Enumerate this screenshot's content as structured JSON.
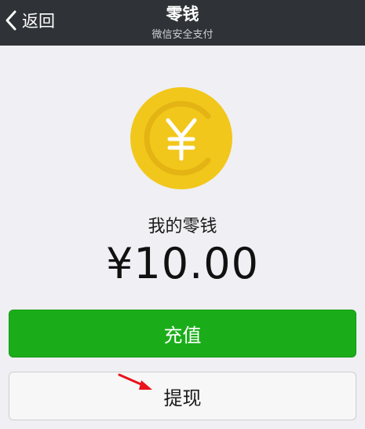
{
  "navbar": {
    "back_label": "返回",
    "title": "零钱",
    "subtitle": "微信安全支付"
  },
  "coin": {
    "symbol": "¥",
    "icon": "yuan-coin-icon",
    "color": "#f2c71b"
  },
  "balance": {
    "label": "我的零钱",
    "amount": "¥10.00"
  },
  "buttons": {
    "recharge_label": "充值",
    "withdraw_label": "提现"
  },
  "colors": {
    "navbar": "#2f3236",
    "background": "#efeff4",
    "primary": "#1aad19",
    "annotation_arrow": "#e8131b"
  }
}
